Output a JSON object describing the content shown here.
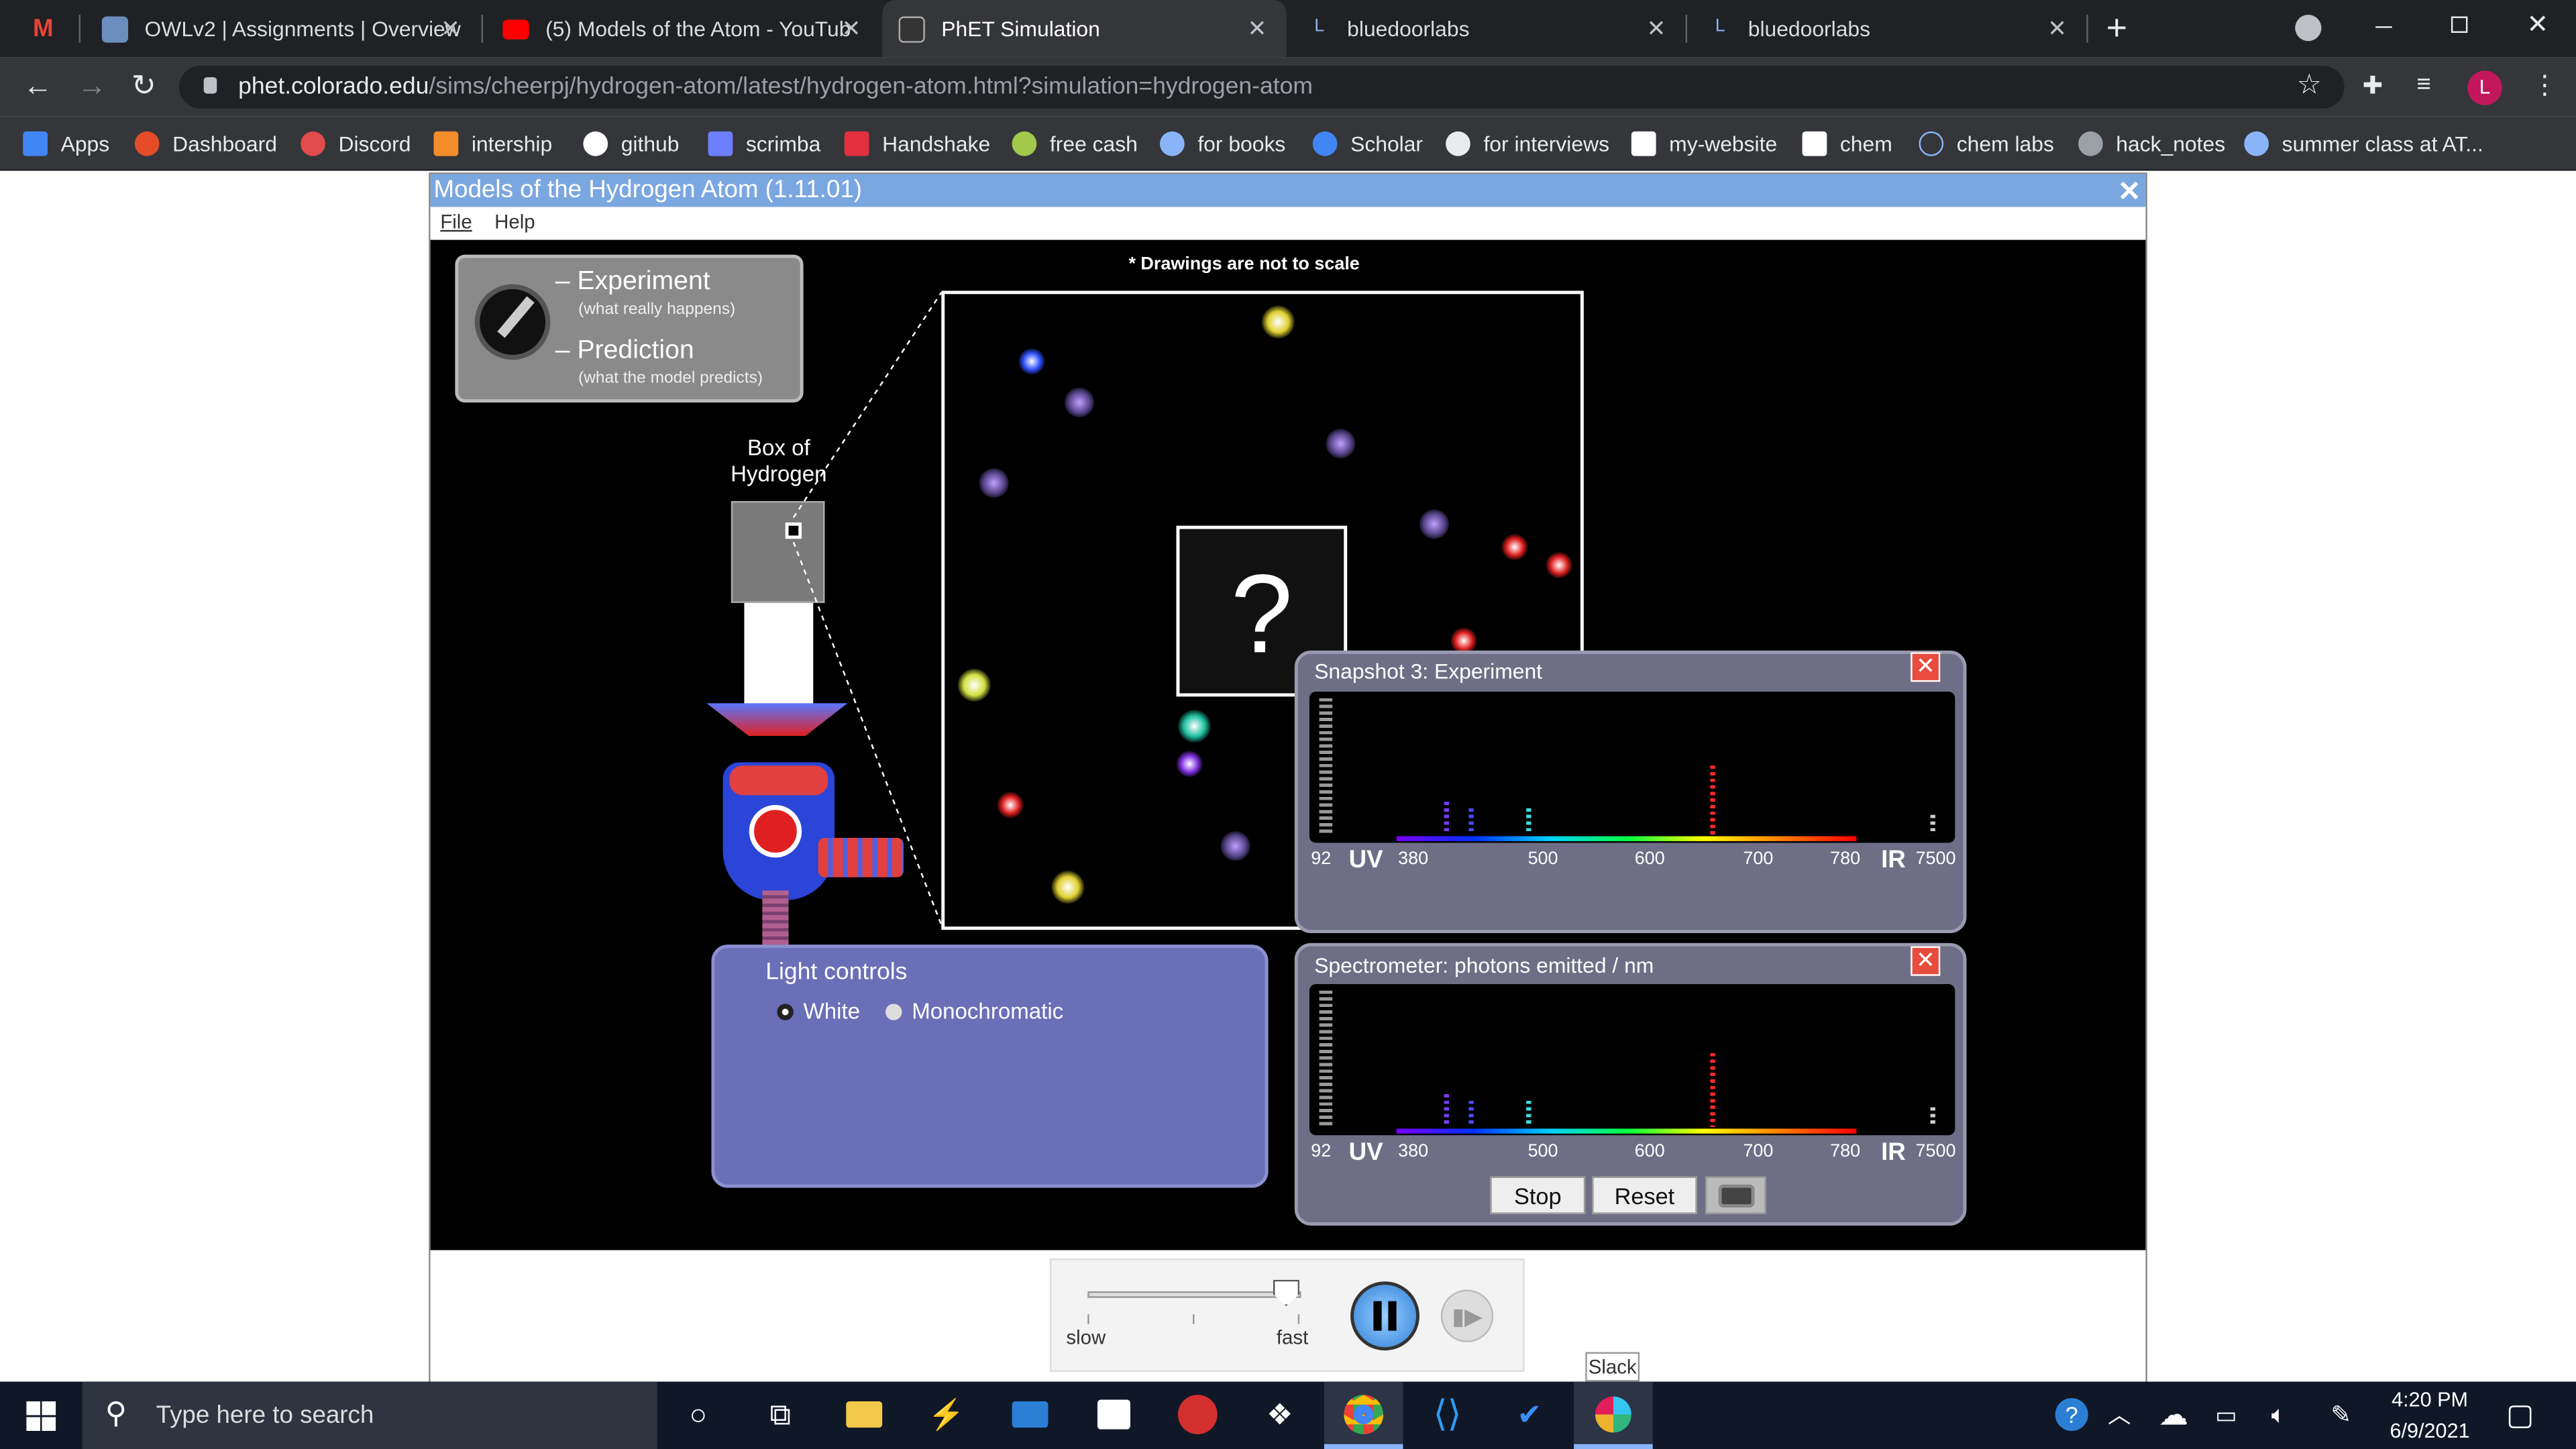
{
  "browser": {
    "tabs": [
      {
        "label": "OWLv2 | Assignments | Overview"
      },
      {
        "label": "(5) Models of the Atom - YouTub"
      },
      {
        "label": "PhET Simulation"
      },
      {
        "label": "bluedoorlabs"
      },
      {
        "label": "bluedoorlabs"
      }
    ],
    "new_tab": "+",
    "url_host": "phet.colorado.edu",
    "url_path": "/sims/cheerpj/hydrogen-atom/latest/hydrogen-atom.html?simulation=hydrogen-atom",
    "profile_initial": "L",
    "bookmarks": [
      "Apps",
      "Dashboard",
      "Discord",
      "intership",
      "github",
      "scrimba",
      "Handshake",
      "free cash",
      "for books",
      "Scholar",
      "for interviews",
      "my-website",
      "chem",
      "chem labs",
      "hack_notes",
      "summer class at AT..."
    ]
  },
  "sim": {
    "title": "Models of the Hydrogen Atom (1.11.01)",
    "menu": {
      "file": "File",
      "help": "Help"
    },
    "mode": {
      "experiment": "Experiment",
      "experiment_sub": "(what really happens)",
      "prediction": "Prediction",
      "prediction_sub": "(what the model predicts)"
    },
    "scale_note": "* Drawings are not to scale",
    "box_label_1": "Box of",
    "box_label_2": "Hydrogen",
    "question_mark": "?",
    "light_controls": {
      "title": "Light controls",
      "white": "White",
      "mono": "Monochromatic",
      "selected": "White"
    },
    "snapshot": {
      "title": "Snapshot 3: Experiment"
    },
    "spectrometer": {
      "title": "Spectrometer: photons emitted / nm",
      "stop": "Stop",
      "reset": "Reset"
    },
    "axis": {
      "uv_start": "92",
      "uv": "UV",
      "t380": "380",
      "t500": "500",
      "t600": "600",
      "t700": "700",
      "t780": "780",
      "ir": "IR",
      "ir_end": "7500"
    },
    "speed": {
      "slow": "slow",
      "fast": "fast",
      "level": 0.93
    }
  },
  "tooltip": "Slack",
  "taskbar": {
    "search_placeholder": "Type here to search",
    "time": "4:20 PM",
    "date": "6/9/2021"
  },
  "colors": {
    "title_bar": "#7ba7e0",
    "panel": "#6b6fb8",
    "tab_bg": "#202124"
  }
}
